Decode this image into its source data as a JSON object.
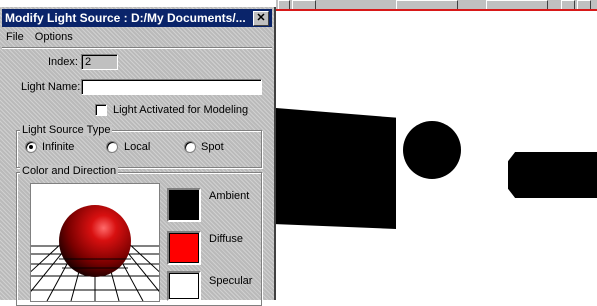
{
  "dialog": {
    "title": "Modify Light Source : D:/My Documents/...",
    "close_glyph": "✕",
    "menu": {
      "file": "File",
      "options": "Options"
    },
    "index": {
      "label": "Index:",
      "value": "2"
    },
    "light_name": {
      "label": "Light Name:",
      "value": ""
    },
    "activated": {
      "label": "Light Activated for Modeling",
      "checked": false
    },
    "source_type": {
      "title": "Light Source Type",
      "options": [
        "Infinite",
        "Local",
        "Spot"
      ],
      "selected": "Infinite"
    },
    "color_direction": {
      "title": "Color and Direction",
      "ambient": {
        "label": "Ambient",
        "color": "#000000"
      },
      "diffuse": {
        "label": "Diffuse",
        "color": "#ff0000"
      },
      "specular": {
        "label": "Specular",
        "color": "#ffffff"
      }
    }
  },
  "colors": {
    "titlebar": "#0a246a",
    "dialog_bg": "#c6c6c6",
    "sphere": "#c40000",
    "accent_red": "#d81818"
  },
  "icons": [
    "close-icon",
    "checkbox",
    "radio-button"
  ]
}
